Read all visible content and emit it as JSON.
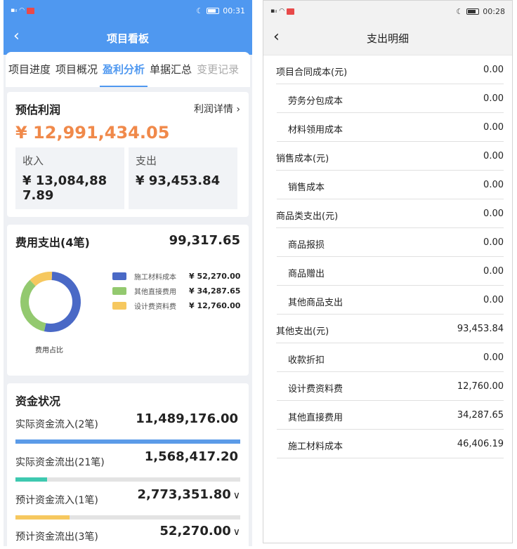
{
  "left": {
    "status_time": "00:31",
    "nav_title": "项目看板",
    "back_glyph": "‹",
    "tabs": [
      "项目进度",
      "项目概况",
      "盈利分析",
      "单据汇总",
      "变更记录"
    ],
    "profit": {
      "title": "预估利润",
      "detail_link": "利润详情 ›",
      "amount": "¥ 12,991,434.05",
      "income_label": "收入",
      "income_value": "¥ 13,084,887.89",
      "expense_label": "支出",
      "expense_value": "¥ 93,453.84"
    },
    "expense": {
      "title": "费用支出(4笔)",
      "total": "99,317.65",
      "donut_label": "费用占比",
      "legend": [
        {
          "name": "施工材料成本",
          "value": "¥ 52,270.00",
          "color": "#4a69c6",
          "amount": 52270.0
        },
        {
          "name": "其他直接费用",
          "value": "¥ 34,287.65",
          "color": "#93c96f",
          "amount": 34287.65
        },
        {
          "name": "设计费资料费",
          "value": "¥ 12,760.00",
          "color": "#f6c85f",
          "amount": 12760.0
        }
      ]
    },
    "fund": {
      "title": "资金状况",
      "rows": [
        {
          "label": "实际资金流入(2笔)",
          "value": "11,489,176.00",
          "chevron": "",
          "fill": 1.0,
          "color": "#5b9be8"
        },
        {
          "label": "实际资金流出(21笔)",
          "value": "1,568,417.20",
          "chevron": "",
          "fill": 0.14,
          "color": "#3ec9b0"
        },
        {
          "label": "预计资金流入(1笔)",
          "value": "2,773,351.80",
          "chevron": "∨",
          "fill": 0.24,
          "color": "#f6c85f"
        },
        {
          "label": "预计资金流出(3笔)",
          "value": "52,270.00",
          "chevron": "∨",
          "fill": 0.0,
          "color": "#f08a5b"
        }
      ]
    }
  },
  "right": {
    "status_time": "00:28",
    "nav_title": "支出明细",
    "back_glyph": "‹",
    "rows": [
      {
        "label": "项目合同成本(元)",
        "value": "0.00",
        "level": "cat"
      },
      {
        "label": "劳务分包成本",
        "value": "0.00",
        "level": "sub"
      },
      {
        "label": "材料领用成本",
        "value": "0.00",
        "level": "sub"
      },
      {
        "label": "销售成本(元)",
        "value": "0.00",
        "level": "cat"
      },
      {
        "label": "销售成本",
        "value": "0.00",
        "level": "sub"
      },
      {
        "label": "商品类支出(元)",
        "value": "0.00",
        "level": "cat"
      },
      {
        "label": "商品报损",
        "value": "0.00",
        "level": "sub"
      },
      {
        "label": "商品赠出",
        "value": "0.00",
        "level": "sub"
      },
      {
        "label": "其他商品支出",
        "value": "0.00",
        "level": "sub"
      },
      {
        "label": "其他支出(元)",
        "value": "93,453.84",
        "level": "cat"
      },
      {
        "label": "收款折扣",
        "value": "0.00",
        "level": "sub"
      },
      {
        "label": "设计费资料费",
        "value": "12,760.00",
        "level": "sub"
      },
      {
        "label": "其他直接费用",
        "value": "34,287.65",
        "level": "sub"
      },
      {
        "label": "施工材料成本",
        "value": "46,406.19",
        "level": "sub"
      }
    ]
  }
}
